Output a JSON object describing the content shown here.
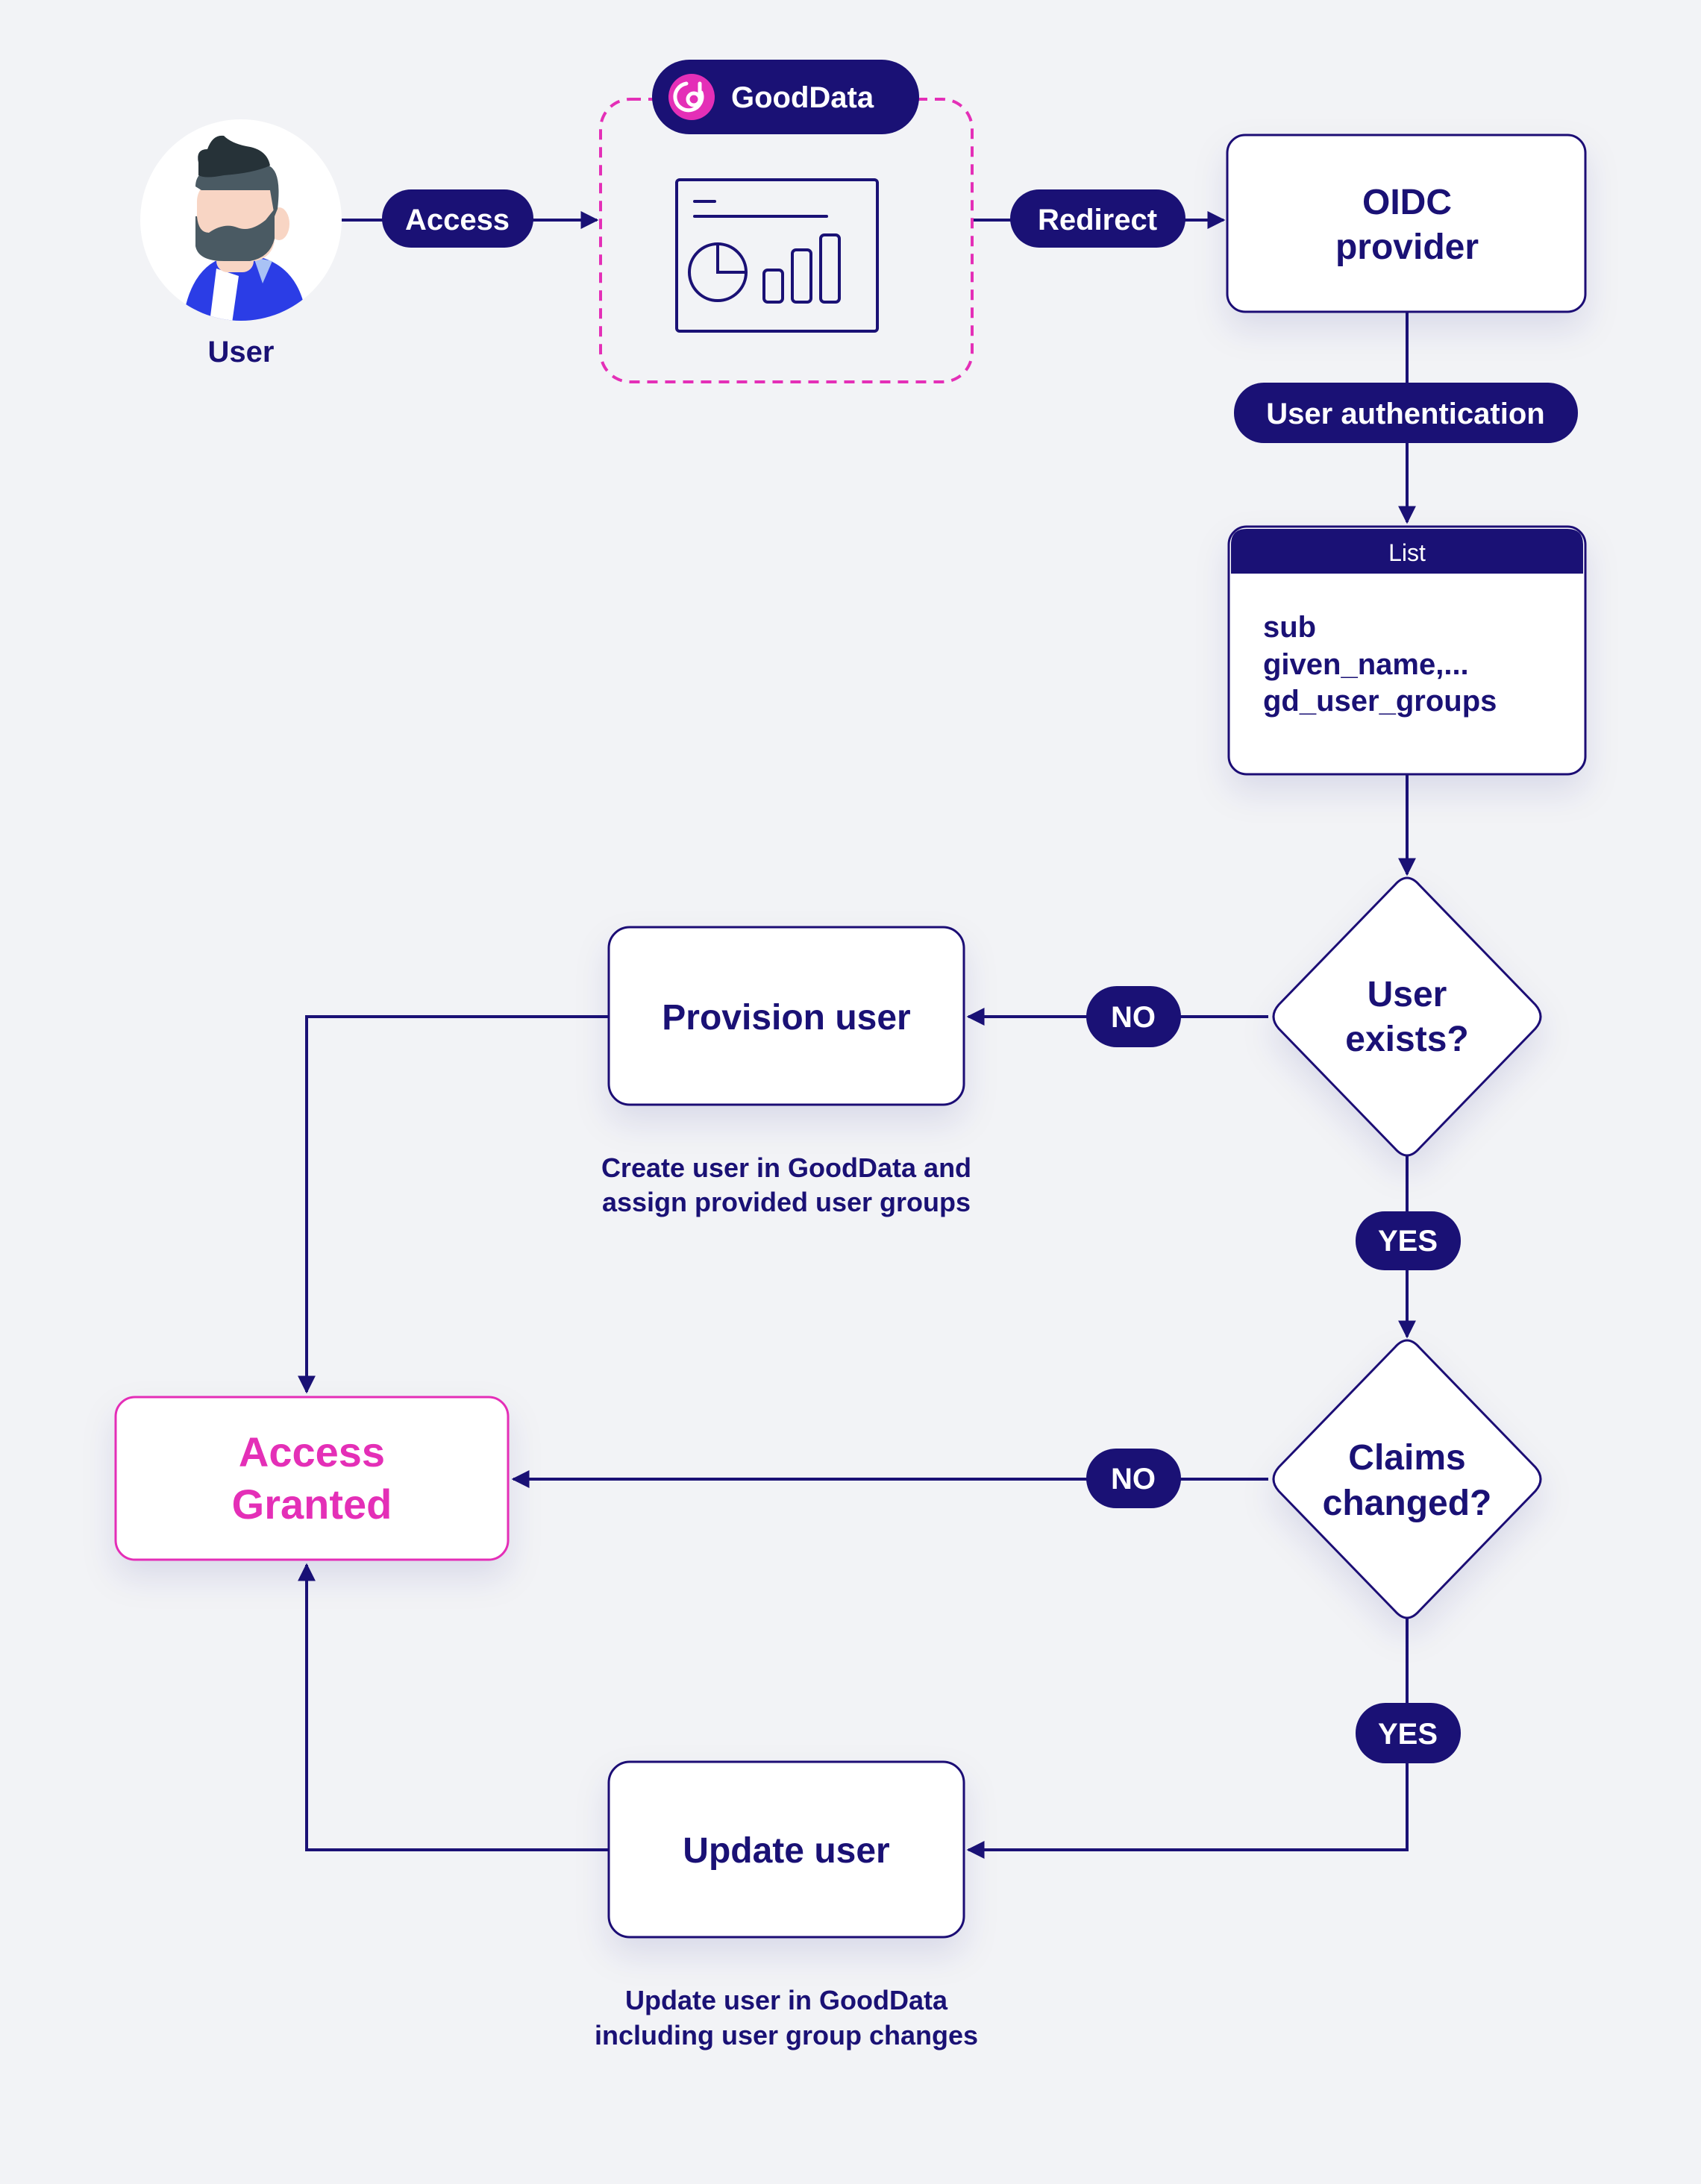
{
  "colors": {
    "background": "#f2f3f6",
    "navy": "#1a1175",
    "accent_pink": "#e42fb7",
    "white": "#ffffff"
  },
  "user": {
    "label": "User",
    "avatar_icon": "bearded-man-avatar"
  },
  "edges": {
    "access": "Access",
    "redirect": "Redirect",
    "user_authentication": "User authentication",
    "no_1": "NO",
    "yes_1": "YES",
    "no_2": "NO",
    "yes_2": "YES"
  },
  "gooddata": {
    "badge_label": "GoodData",
    "logo_icon": "gooddata-logo",
    "app_icon": "dashboard-icon"
  },
  "oidc": {
    "line1": "OIDC",
    "line2": "provider"
  },
  "claims_list": {
    "header": "List",
    "items": [
      "sub",
      "given_name,...",
      "gd_user_groups"
    ]
  },
  "decision_user_exists": {
    "line1": "User",
    "line2": "exists?"
  },
  "decision_claims_changed": {
    "line1": "Claims",
    "line2": "changed?"
  },
  "provision_user": {
    "label": "Provision user",
    "caption_line1": "Create user in GoodData and",
    "caption_line2": "assign provided user groups"
  },
  "update_user": {
    "label": "Update user",
    "caption_line1": "Update user in GoodData",
    "caption_line2": "including user group changes"
  },
  "access_granted": {
    "line1": "Access",
    "line2": "Granted"
  }
}
